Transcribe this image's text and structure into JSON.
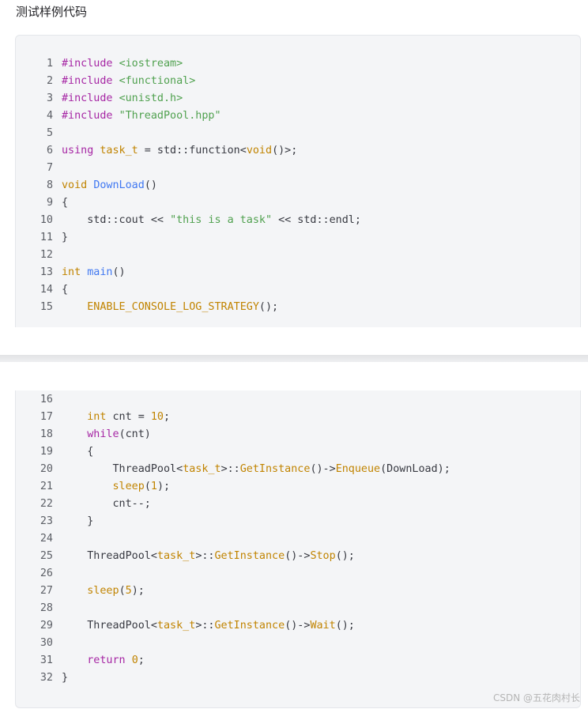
{
  "heading": "测试样例代码",
  "watermark": "CSDN @五花肉村长",
  "code_top": [
    {
      "n": "1",
      "tokens": [
        {
          "t": "#include ",
          "c": "kw"
        },
        {
          "t": "<iostream>",
          "c": "str"
        }
      ]
    },
    {
      "n": "2",
      "tokens": [
        {
          "t": "#include ",
          "c": "kw"
        },
        {
          "t": "<functional>",
          "c": "str"
        }
      ]
    },
    {
      "n": "3",
      "tokens": [
        {
          "t": "#include ",
          "c": "kw"
        },
        {
          "t": "<unistd.h>",
          "c": "str"
        }
      ]
    },
    {
      "n": "4",
      "tokens": [
        {
          "t": "#include ",
          "c": "kw"
        },
        {
          "t": "\"ThreadPool.hpp\"",
          "c": "str"
        }
      ]
    },
    {
      "n": "5",
      "tokens": []
    },
    {
      "n": "6",
      "tokens": [
        {
          "t": "using ",
          "c": "kw"
        },
        {
          "t": "task_t",
          "c": "ty"
        },
        {
          "t": " = std::function<",
          "c": ""
        },
        {
          "t": "void",
          "c": "ty"
        },
        {
          "t": "()>;",
          "c": ""
        }
      ]
    },
    {
      "n": "7",
      "tokens": []
    },
    {
      "n": "8",
      "tokens": [
        {
          "t": "void ",
          "c": "ty"
        },
        {
          "t": "DownLoad",
          "c": "fn"
        },
        {
          "t": "()",
          "c": ""
        }
      ]
    },
    {
      "n": "9",
      "tokens": [
        {
          "t": "{",
          "c": ""
        }
      ]
    },
    {
      "n": "10",
      "tokens": [
        {
          "t": "    std::cout << ",
          "c": ""
        },
        {
          "t": "\"this is a task\"",
          "c": "str"
        },
        {
          "t": " << std::endl;",
          "c": ""
        }
      ]
    },
    {
      "n": "11",
      "tokens": [
        {
          "t": "}",
          "c": ""
        }
      ]
    },
    {
      "n": "12",
      "tokens": []
    },
    {
      "n": "13",
      "tokens": [
        {
          "t": "int ",
          "c": "ty"
        },
        {
          "t": "main",
          "c": "fn"
        },
        {
          "t": "()",
          "c": ""
        }
      ]
    },
    {
      "n": "14",
      "tokens": [
        {
          "t": "{",
          "c": ""
        }
      ]
    },
    {
      "n": "15",
      "tokens": [
        {
          "t": "    ",
          "c": ""
        },
        {
          "t": "ENABLE_CONSOLE_LOG_STRATEGY",
          "c": "call"
        },
        {
          "t": "();",
          "c": ""
        }
      ]
    }
  ],
  "code_bottom": [
    {
      "n": "16",
      "tokens": []
    },
    {
      "n": "17",
      "tokens": [
        {
          "t": "    ",
          "c": ""
        },
        {
          "t": "int",
          "c": "ty"
        },
        {
          "t": " cnt = ",
          "c": ""
        },
        {
          "t": "10",
          "c": "num"
        },
        {
          "t": ";",
          "c": ""
        }
      ]
    },
    {
      "n": "18",
      "tokens": [
        {
          "t": "    ",
          "c": ""
        },
        {
          "t": "while",
          "c": "kw"
        },
        {
          "t": "(cnt)",
          "c": ""
        }
      ]
    },
    {
      "n": "19",
      "tokens": [
        {
          "t": "    {",
          "c": ""
        }
      ]
    },
    {
      "n": "20",
      "tokens": [
        {
          "t": "        ThreadPool<",
          "c": ""
        },
        {
          "t": "task_t",
          "c": "ty"
        },
        {
          "t": ">::",
          "c": ""
        },
        {
          "t": "GetInstance",
          "c": "call"
        },
        {
          "t": "()->",
          "c": ""
        },
        {
          "t": "Enqueue",
          "c": "call"
        },
        {
          "t": "(DownLoad);",
          "c": ""
        }
      ]
    },
    {
      "n": "21",
      "tokens": [
        {
          "t": "        ",
          "c": ""
        },
        {
          "t": "sleep",
          "c": "call"
        },
        {
          "t": "(",
          "c": ""
        },
        {
          "t": "1",
          "c": "num"
        },
        {
          "t": ");",
          "c": ""
        }
      ]
    },
    {
      "n": "22",
      "tokens": [
        {
          "t": "        cnt--;",
          "c": ""
        }
      ]
    },
    {
      "n": "23",
      "tokens": [
        {
          "t": "    }",
          "c": ""
        }
      ]
    },
    {
      "n": "24",
      "tokens": []
    },
    {
      "n": "25",
      "tokens": [
        {
          "t": "    ThreadPool<",
          "c": ""
        },
        {
          "t": "task_t",
          "c": "ty"
        },
        {
          "t": ">::",
          "c": ""
        },
        {
          "t": "GetInstance",
          "c": "call"
        },
        {
          "t": "()->",
          "c": ""
        },
        {
          "t": "Stop",
          "c": "call"
        },
        {
          "t": "();",
          "c": ""
        }
      ]
    },
    {
      "n": "26",
      "tokens": []
    },
    {
      "n": "27",
      "tokens": [
        {
          "t": "    ",
          "c": ""
        },
        {
          "t": "sleep",
          "c": "call"
        },
        {
          "t": "(",
          "c": ""
        },
        {
          "t": "5",
          "c": "num"
        },
        {
          "t": ");",
          "c": ""
        }
      ]
    },
    {
      "n": "28",
      "tokens": []
    },
    {
      "n": "29",
      "tokens": [
        {
          "t": "    ThreadPool<",
          "c": ""
        },
        {
          "t": "task_t",
          "c": "ty"
        },
        {
          "t": ">::",
          "c": ""
        },
        {
          "t": "GetInstance",
          "c": "call"
        },
        {
          "t": "()->",
          "c": ""
        },
        {
          "t": "Wait",
          "c": "call"
        },
        {
          "t": "();",
          "c": ""
        }
      ]
    },
    {
      "n": "30",
      "tokens": []
    },
    {
      "n": "31",
      "tokens": [
        {
          "t": "    ",
          "c": ""
        },
        {
          "t": "return",
          "c": "kw"
        },
        {
          "t": " ",
          "c": ""
        },
        {
          "t": "0",
          "c": "num"
        },
        {
          "t": ";",
          "c": ""
        }
      ]
    },
    {
      "n": "32",
      "tokens": [
        {
          "t": "}",
          "c": ""
        }
      ]
    }
  ]
}
